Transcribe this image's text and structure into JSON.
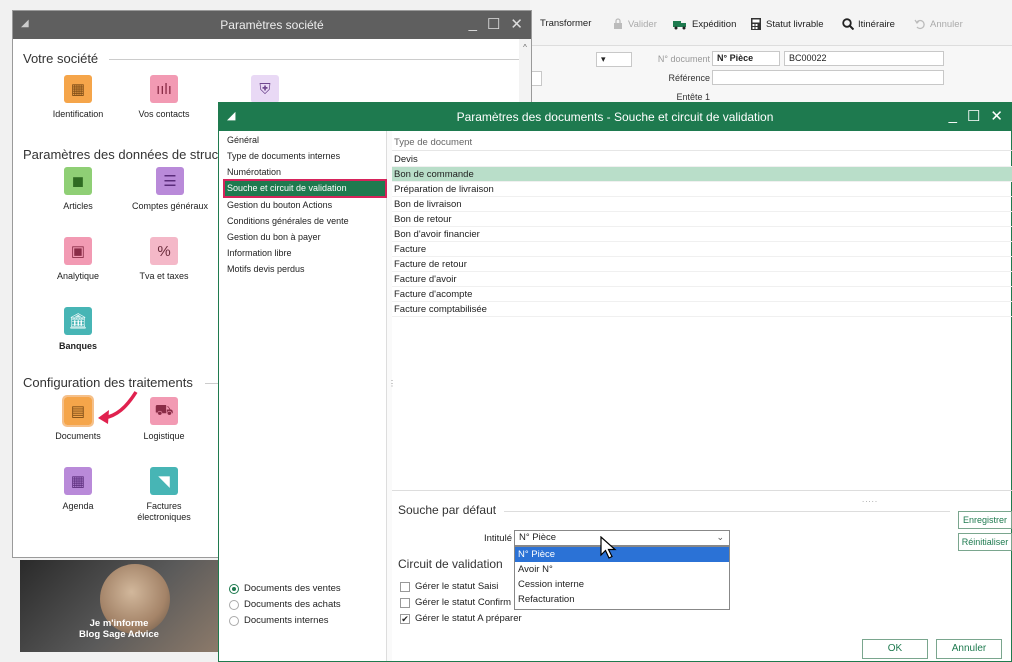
{
  "colors": {
    "sage_green": "#1e7a4f",
    "selection_outline": "#d6235b",
    "row_selected": "#b9dec9",
    "dropdown_highlight": "#2b72d6",
    "societe_titlebar": "#5f5f5f"
  },
  "toolbar": {
    "items": [
      {
        "label": "Transformer",
        "icon": "",
        "enabled": true
      },
      {
        "label": "Valider",
        "icon": "lock-icon",
        "enabled": false
      },
      {
        "label": "Expédition",
        "icon": "truck-icon",
        "enabled": true
      },
      {
        "label": "Statut livrable",
        "icon": "calculator-icon",
        "enabled": true
      },
      {
        "label": "Itinéraire",
        "icon": "search-icon",
        "enabled": true
      },
      {
        "label": "Annuler",
        "icon": "undo-icon",
        "enabled": false
      }
    ]
  },
  "doc_form": {
    "numero_label": "N° document",
    "numero_value": "N° Pièce",
    "piece_number": "BC00022",
    "reference_label": "Référence",
    "entete_label": "Entête 1"
  },
  "societe": {
    "title": "Paramètres société",
    "section_company": "Votre société",
    "company_tiles": [
      {
        "label": "Identification",
        "icon": "building-icon",
        "color": "orange"
      },
      {
        "label": "Vos contacts",
        "icon": "people-icon",
        "color": "pink"
      },
      {
        "label": "",
        "icon": "shield-icon",
        "color": "lavender"
      }
    ],
    "section_data": "Paramètres des données de struc",
    "data_tiles": [
      {
        "label": "Articles",
        "icon": "cube-icon",
        "color": "green"
      },
      {
        "label": "Comptes généraux",
        "icon": "ledger-icon",
        "color": "purple"
      },
      {
        "label": "Analytique",
        "icon": "chart-box-icon",
        "color": "pink"
      },
      {
        "label": "Tva et taxes",
        "icon": "percent-icon",
        "color": "lightpink"
      },
      {
        "label": "Banques",
        "icon": "bank-icon",
        "color": "teal"
      }
    ],
    "section_process": "Configuration des traitements",
    "process_tiles": [
      {
        "label": "Documents",
        "icon": "document-icon",
        "color": "orange"
      },
      {
        "label": "Logistique",
        "icon": "forklift-icon",
        "color": "pink"
      },
      {
        "label": "Agenda",
        "icon": "calendar-icon",
        "color": "purple"
      },
      {
        "label": "Factures électroniques",
        "icon": "rss-icon",
        "color": "teal"
      }
    ]
  },
  "ad": {
    "line1": "Je m'informe",
    "line2": "Blog Sage Advice"
  },
  "dialog": {
    "title": "Paramètres des documents - Souche et circuit de validation",
    "nav": [
      {
        "label": "Général",
        "selected": false
      },
      {
        "label": "Type de documents internes",
        "selected": false
      },
      {
        "label": "Numérotation",
        "selected": false
      },
      {
        "label": "Souche et circuit de validation",
        "selected": true
      },
      {
        "label": "Gestion du bouton Actions",
        "selected": false
      },
      {
        "label": "Conditions générales de vente",
        "selected": false
      },
      {
        "label": "Gestion du bon à payer",
        "selected": false
      },
      {
        "label": "Information libre",
        "selected": false
      },
      {
        "label": "Motifs devis perdus",
        "selected": false
      }
    ],
    "doc_types": [
      {
        "label": "Documents des ventes",
        "checked": true
      },
      {
        "label": "Documents des achats",
        "checked": false
      },
      {
        "label": "Documents internes",
        "checked": false
      }
    ],
    "list_header": "Type de document",
    "list_rows": [
      {
        "label": "Devis",
        "selected": false
      },
      {
        "label": "Bon de commande",
        "selected": true
      },
      {
        "label": "Préparation de livraison",
        "selected": false
      },
      {
        "label": "Bon de livraison",
        "selected": false
      },
      {
        "label": "Bon de retour",
        "selected": false
      },
      {
        "label": "Bon d'avoir financier",
        "selected": false
      },
      {
        "label": "Facture",
        "selected": false
      },
      {
        "label": "Facture de retour",
        "selected": false
      },
      {
        "label": "Facture d'avoir",
        "selected": false
      },
      {
        "label": "Facture d'acompte",
        "selected": false
      },
      {
        "label": "Facture comptabilisée",
        "selected": false
      }
    ],
    "souche": {
      "title": "Souche par défaut",
      "intitule_label": "Intitulé",
      "selected_value": "N° Pièce",
      "options": [
        {
          "label": "N° Pièce",
          "highlighted": true
        },
        {
          "label": "Avoir N°",
          "highlighted": false
        },
        {
          "label": "Cession interne",
          "highlighted": false
        },
        {
          "label": "Refacturation",
          "highlighted": false
        }
      ]
    },
    "circuit": {
      "title": "Circuit de validation",
      "checks": [
        {
          "label": "Gérer le statut Saisi",
          "checked": false
        },
        {
          "label": "Gérer le statut Confirm",
          "checked": false
        },
        {
          "label": "Gérer le statut A préparer",
          "checked": true
        }
      ]
    },
    "buttons": {
      "save": "Enregistrer",
      "reset": "Réinitialiser",
      "ok": "OK",
      "cancel": "Annuler"
    }
  }
}
